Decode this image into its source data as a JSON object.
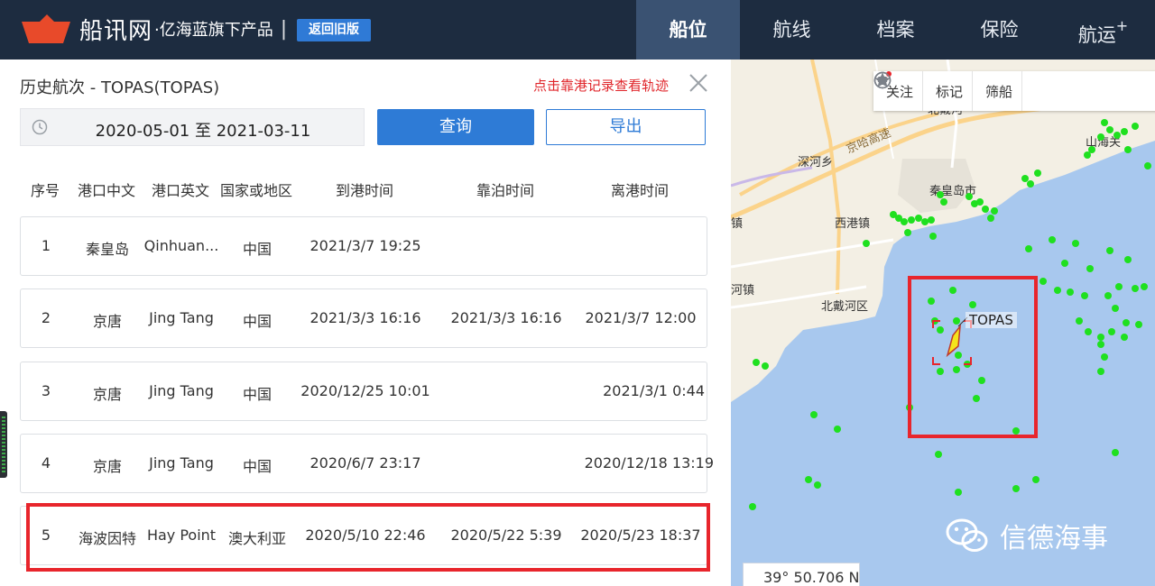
{
  "header": {
    "brand_main": "船讯网",
    "brand_sub": "·亿海蓝旗下产品",
    "separator": "|",
    "back_button": "返回旧版",
    "nav": [
      {
        "label": "船位",
        "active": true
      },
      {
        "label": "航线",
        "active": false
      },
      {
        "label": "档案",
        "active": false
      },
      {
        "label": "保险",
        "active": false
      },
      {
        "label": "航运",
        "suffix": "+",
        "active": false
      }
    ]
  },
  "panel": {
    "title": "历史航次 - TOPAS(TOPAS)",
    "hint": "点击靠港记录查看轨迹",
    "date_range": "2020-05-01 至 2021-03-11",
    "query_button": "查询",
    "export_button": "导出",
    "columns": [
      "序号",
      "港口中文",
      "港口英文",
      "国家或地区",
      "到港时间",
      "靠泊时间",
      "离港时间"
    ],
    "rows": [
      {
        "no": "1",
        "port_cn": "秦皇岛",
        "port_en": "Qinhuan...",
        "country": "中国",
        "arrival": "2021/3/7 19:25",
        "berth": "",
        "departure": ""
      },
      {
        "no": "2",
        "port_cn": "京唐",
        "port_en": "Jing Tang",
        "country": "中国",
        "arrival": "2021/3/3 16:16",
        "berth": "2021/3/3 16:16",
        "departure": "2021/3/7 12:00"
      },
      {
        "no": "3",
        "port_cn": "京唐",
        "port_en": "Jing Tang",
        "country": "中国",
        "arrival": "2020/12/25 10:01",
        "berth": "",
        "departure": "2021/3/1 0:44"
      },
      {
        "no": "4",
        "port_cn": "京唐",
        "port_en": "Jing Tang",
        "country": "中国",
        "arrival": "2020/6/7 23:17",
        "berth": "",
        "departure": "2020/12/18 13:19"
      },
      {
        "no": "5",
        "port_cn": "海波因特",
        "port_en": "Hay Point",
        "country": "澳大利亚",
        "arrival": "2020/5/10 22:46",
        "berth": "2020/5/22 5:39",
        "departure": "2020/5/23 18:37"
      }
    ]
  },
  "map": {
    "toolbar": [
      {
        "label": "关注",
        "icon": "star-icon"
      },
      {
        "label": "标记",
        "icon": "tag-icon"
      },
      {
        "label": "筛船",
        "icon": "filter-icon"
      },
      {
        "label": "",
        "icon": "layers-icon"
      }
    ],
    "places": [
      "北戴河",
      "山海关",
      "深河乡",
      "京哈高速",
      "秦皇岛市",
      "西港镇",
      "北戴河区",
      "河镇",
      "镇"
    ],
    "ship_label": "TOPAS",
    "coordinate": "39° 50.706 N",
    "watermark": "信德海事"
  },
  "colors": {
    "header_bg": "#1d2c40",
    "nav_active_bg": "#3a5272",
    "primary": "#2e7bd6",
    "hint_red": "#e0262b",
    "highlight_red": "#e8252c",
    "sea": "#a8c8ee",
    "ship_dot": "#1fe01f"
  }
}
